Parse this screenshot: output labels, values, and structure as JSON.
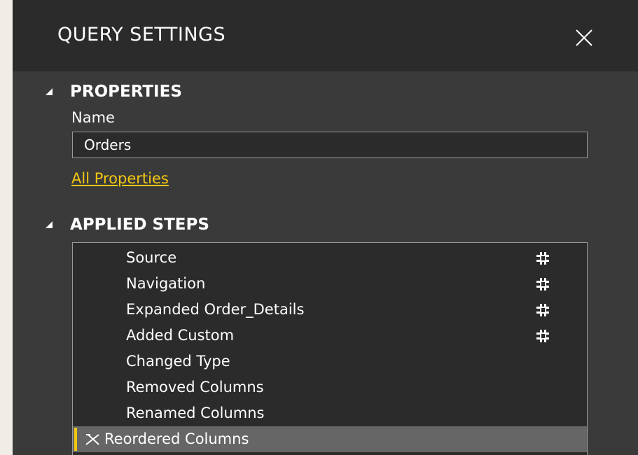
{
  "header": {
    "title": "QUERY SETTINGS",
    "close_icon": "close-icon"
  },
  "properties": {
    "section_label": "PROPERTIES",
    "name_label": "Name",
    "name_value": "Orders",
    "all_properties_link": "All Properties"
  },
  "applied_steps": {
    "section_label": "APPLIED STEPS",
    "steps": [
      {
        "label": "Source",
        "has_settings": true,
        "selected": false
      },
      {
        "label": "Navigation",
        "has_settings": true,
        "selected": false
      },
      {
        "label": "Expanded Order_Details",
        "has_settings": true,
        "selected": false
      },
      {
        "label": "Added Custom",
        "has_settings": true,
        "selected": false
      },
      {
        "label": "Changed Type",
        "has_settings": false,
        "selected": false
      },
      {
        "label": "Removed Columns",
        "has_settings": false,
        "selected": false
      },
      {
        "label": "Renamed Columns",
        "has_settings": false,
        "selected": false
      },
      {
        "label": "Reordered Columns",
        "has_settings": false,
        "selected": true
      }
    ]
  },
  "colors": {
    "panel_bg": "#3a3a3a",
    "header_bg": "#2b2b2b",
    "box_bg": "#2b2b2b",
    "accent": "#f2c811",
    "selected_row": "#666666",
    "text": "#ffffff"
  }
}
